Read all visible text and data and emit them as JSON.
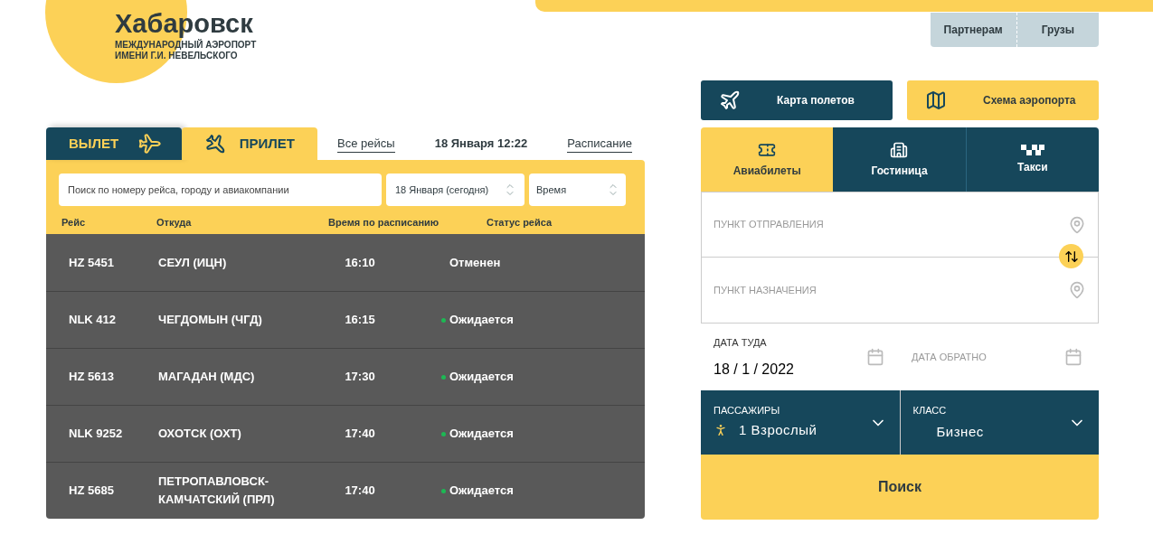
{
  "logo": {
    "title": "Хабаровск",
    "subtitle_1": "МЕЖДУНАРОДНЫЙ АЭРОПОРТ",
    "subtitle_2": "ИМЕНИ Г.И. НЕВЕЛЬСКОГО"
  },
  "top_links": [
    "Партнерам",
    "Грузы"
  ],
  "flight_tabs": [
    {
      "label": "ВЫЛЕТ",
      "kind": "departure",
      "selected": false
    },
    {
      "label": "ПРИЛЕТ",
      "kind": "arrival",
      "selected": true
    }
  ],
  "links": {
    "all_flights": "Все рейсы",
    "datetime": "18 Января 12:22",
    "schedule": "Расписание"
  },
  "filters": {
    "search": {
      "placeholder": "Поиск по номеру рейса, городу и авиакомпании"
    },
    "date": {
      "value": "18 Января (сегодня)"
    },
    "time": {
      "value": "Время"
    }
  },
  "table": {
    "columns": [
      "Рейс",
      "Откуда",
      "Время по расписанию",
      "Статус рейса"
    ],
    "rows": [
      {
        "flight": "HZ 5451",
        "from": "СЕУЛ (ИЦН)",
        "time": "16:10",
        "status": "Отменен"
      },
      {
        "flight": "NLK 412",
        "from": "ЧЕГДОМЫН (ЧГД)",
        "time": "16:15",
        "status": "Ожидается",
        "color": "#1db954"
      },
      {
        "flight": "HZ 5613",
        "from": "МАГАДАН (МДС)",
        "time": "17:30",
        "status": "Ожидается",
        "color": "#1db954"
      },
      {
        "flight": "NLK 9252",
        "from": "ОХОТСК (ОХТ)",
        "time": "17:40",
        "status": "Ожидается",
        "color": "#1db954"
      },
      {
        "flight": "HZ 5685",
        "from": "ПЕТРОПАВЛОВСК-КАМЧАТСКИЙ (ПРЛ)",
        "time": "17:40",
        "status": "Ожидается",
        "color": "#1db954"
      }
    ]
  },
  "quick_buttons": [
    {
      "label": "Карта полетов",
      "kind": "flight-map"
    },
    {
      "label": "Схема аэропорта",
      "kind": "airport-map"
    }
  ],
  "booking_tabs": [
    {
      "label": "Авиабилеты",
      "kind": "tickets",
      "selected": true
    },
    {
      "label": "Гостиница",
      "kind": "hotel",
      "selected": false
    },
    {
      "label": "Такси",
      "kind": "taxi",
      "selected": false
    }
  ],
  "booking": {
    "origin": {
      "placeholder": "ПУНКТ ОТПРАВЛЕНИЯ"
    },
    "destination": {
      "placeholder": "ПУНКТ НАЗНАЧЕНИЯ"
    },
    "date_there": {
      "label": "ДАТА ТУДА",
      "value": "18 / 1 / 2022"
    },
    "date_back": {
      "placeholder": "ДАТА ОБРАТНО"
    },
    "passengers": {
      "label": "ПАССАЖИРЫ",
      "value": "1 Взрослый"
    },
    "class": {
      "label": "КЛАСС",
      "value": "Бизнес"
    },
    "search_button": "Поиск"
  }
}
